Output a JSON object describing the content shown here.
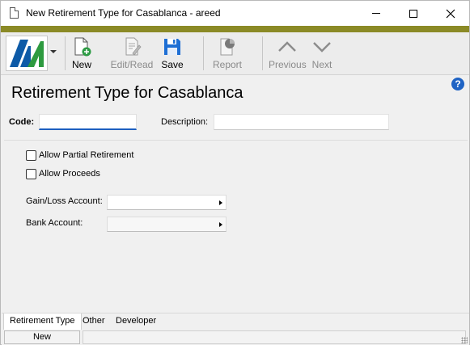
{
  "window": {
    "title": "New Retirement Type for Casablanca - areed"
  },
  "toolbar": {
    "new_label": "New",
    "edit_read_label": "Edit/Read",
    "save_label": "Save",
    "report_label": "Report",
    "previous_label": "Previous",
    "next_label": "Next"
  },
  "form": {
    "heading": "Retirement Type for Casablanca",
    "code_label": "Code:",
    "code_value": "",
    "description_label": "Description:",
    "description_value": "",
    "allow_partial_retirement": {
      "label": "Allow Partial Retirement",
      "checked": false
    },
    "allow_proceeds": {
      "label": "Allow Proceeds",
      "checked": false
    },
    "gain_loss_account_label": "Gain/Loss Account:",
    "gain_loss_account_value": "",
    "bank_account_label": "Bank Account:",
    "bank_account_value": ""
  },
  "tabs": [
    {
      "label": "Retirement Type",
      "active": true
    },
    {
      "label": "Other",
      "active": false
    },
    {
      "label": "Developer",
      "active": false
    }
  ],
  "status": {
    "mode": "New"
  },
  "colors": {
    "accent_bar": "#8b8a26",
    "focus_underline": "#1d5fbf",
    "help_icon": "#1f63c4",
    "save_icon": "#1e6fd4"
  }
}
